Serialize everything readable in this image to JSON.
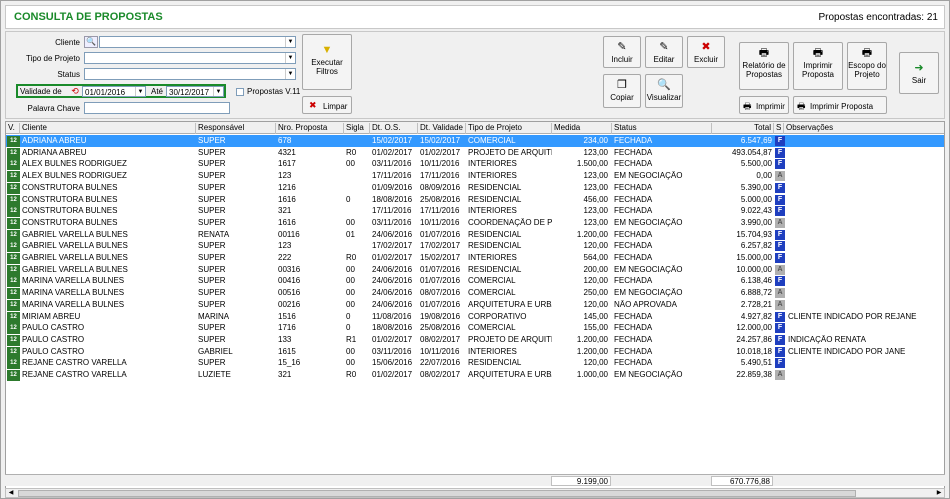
{
  "title": "CONSULTA DE PROPOSTAS",
  "found": "Propostas encontradas: 21",
  "filters": {
    "cliente_label": "Cliente",
    "tipo_label": "Tipo de Projeto",
    "status_label": "Status",
    "validade_label": "Validade de",
    "validade_from": "01/01/2016",
    "ate_label": "Até",
    "validade_to": "30/12/2017",
    "propostas_v11_label": "Propostas V.11",
    "palavra_label": "Palavra Chave"
  },
  "buttons": {
    "executar": "Executar Filtros",
    "limpar": "Limpar",
    "incluir": "Incluir",
    "editar": "Editar",
    "excluir": "Excluir",
    "copiar": "Copiar",
    "visualizar": "Visualizar",
    "relatorio": "Relatório de Propostas",
    "imprimir_proposta_big": "Imprimir Proposta",
    "escopo": "Escopo do Projeto",
    "imprimir": "Imprimir",
    "imprimir_proposta": "Imprimir Proposta",
    "sair": "Sair"
  },
  "columns": [
    "V.",
    "Cliente",
    "Responsável",
    "Nro. Proposta",
    "Sigla",
    "Dt. O.S.",
    "Dt. Validade",
    "Tipo de Projeto",
    "Medida",
    "Status",
    "Total",
    "S",
    "Observações"
  ],
  "rows": [
    {
      "v": "12",
      "cliente": "ADRIANA ABREU",
      "resp": "SUPER",
      "nro": "678",
      "sigla": "",
      "dtos": "15/02/2017",
      "dtval": "15/02/2017",
      "tipo": "COMERCIAL",
      "medida": "234,00",
      "status": "FECHADA",
      "total": "6.547,69",
      "s": "F",
      "obs": ""
    },
    {
      "v": "12",
      "cliente": "ADRIANA ABREU",
      "resp": "SUPER",
      "nro": "4321",
      "sigla": "R0",
      "dtos": "01/02/2017",
      "dtval": "01/02/2017",
      "tipo": "PROJETO DE ARQUITE",
      "medida": "123,00",
      "status": "FECHADA",
      "total": "493.054,87",
      "s": "F",
      "obs": ""
    },
    {
      "v": "12",
      "cliente": "ALEX BULNES RODRIGUEZ",
      "resp": "SUPER",
      "nro": "1617",
      "sigla": "00",
      "dtos": "03/11/2016",
      "dtval": "10/11/2016",
      "tipo": "INTERIORES",
      "medida": "1.500,00",
      "status": "FECHADA",
      "total": "5.500,00",
      "s": "F",
      "obs": ""
    },
    {
      "v": "12",
      "cliente": "ALEX BULNES RODRIGUEZ",
      "resp": "SUPER",
      "nro": "123",
      "sigla": "",
      "dtos": "17/11/2016",
      "dtval": "17/11/2016",
      "tipo": "INTERIORES",
      "medida": "123,00",
      "status": "EM NEGOCIAÇÃO",
      "total": "0,00",
      "s": "A",
      "obs": ""
    },
    {
      "v": "12",
      "cliente": "CONSTRUTORA BULNES",
      "resp": "SUPER",
      "nro": "1216",
      "sigla": "",
      "dtos": "01/09/2016",
      "dtval": "08/09/2016",
      "tipo": "RESIDENCIAL",
      "medida": "123,00",
      "status": "FECHADA",
      "total": "5.390,00",
      "s": "F",
      "obs": ""
    },
    {
      "v": "12",
      "cliente": "CONSTRUTORA BULNES",
      "resp": "SUPER",
      "nro": "1616",
      "sigla": "0",
      "dtos": "18/08/2016",
      "dtval": "25/08/2016",
      "tipo": "RESIDENCIAL",
      "medida": "456,00",
      "status": "FECHADA",
      "total": "5.000,00",
      "s": "F",
      "obs": ""
    },
    {
      "v": "12",
      "cliente": "CONSTRUTORA BULNES",
      "resp": "SUPER",
      "nro": "321",
      "sigla": "",
      "dtos": "17/11/2016",
      "dtval": "17/11/2016",
      "tipo": "INTERIORES",
      "medida": "123,00",
      "status": "FECHADA",
      "total": "9.022,43",
      "s": "F",
      "obs": ""
    },
    {
      "v": "12",
      "cliente": "CONSTRUTORA BULNES",
      "resp": "SUPER",
      "nro": "1616",
      "sigla": "00",
      "dtos": "03/11/2016",
      "dtval": "10/11/2016",
      "tipo": "COORDENAÇÃO DE PF",
      "medida": "123,00",
      "status": "EM NEGOCIAÇÃO",
      "total": "3.990,00",
      "s": "A",
      "obs": ""
    },
    {
      "v": "12",
      "cliente": "GABRIEL VARELLA BULNES",
      "resp": "RENATA",
      "nro": "00116",
      "sigla": "01",
      "dtos": "24/06/2016",
      "dtval": "01/07/2016",
      "tipo": "RESIDENCIAL",
      "medida": "1.200,00",
      "status": "FECHADA",
      "total": "15.704,93",
      "s": "F",
      "obs": ""
    },
    {
      "v": "12",
      "cliente": "GABRIEL VARELLA BULNES",
      "resp": "SUPER",
      "nro": "123",
      "sigla": "",
      "dtos": "17/02/2017",
      "dtval": "17/02/2017",
      "tipo": "RESIDENCIAL",
      "medida": "120,00",
      "status": "FECHADA",
      "total": "6.257,82",
      "s": "F",
      "obs": ""
    },
    {
      "v": "12",
      "cliente": "GABRIEL VARELLA BULNES",
      "resp": "SUPER",
      "nro": "222",
      "sigla": "R0",
      "dtos": "01/02/2017",
      "dtval": "15/02/2017",
      "tipo": "INTERIORES",
      "medida": "564,00",
      "status": "FECHADA",
      "total": "15.000,00",
      "s": "F",
      "obs": ""
    },
    {
      "v": "12",
      "cliente": "GABRIEL VARELLA BULNES",
      "resp": "SUPER",
      "nro": "00316",
      "sigla": "00",
      "dtos": "24/06/2016",
      "dtval": "01/07/2016",
      "tipo": "RESIDENCIAL",
      "medida": "200,00",
      "status": "EM NEGOCIAÇÃO",
      "total": "10.000,00",
      "s": "A",
      "obs": ""
    },
    {
      "v": "12",
      "cliente": "MARINA VARELLA BULNES",
      "resp": "SUPER",
      "nro": "00416",
      "sigla": "00",
      "dtos": "24/06/2016",
      "dtval": "01/07/2016",
      "tipo": "COMERCIAL",
      "medida": "120,00",
      "status": "FECHADA",
      "total": "6.138,46",
      "s": "F",
      "obs": ""
    },
    {
      "v": "12",
      "cliente": "MARINA VARELLA BULNES",
      "resp": "SUPER",
      "nro": "00516",
      "sigla": "00",
      "dtos": "24/06/2016",
      "dtval": "08/07/2016",
      "tipo": "COMERCIAL",
      "medida": "250,00",
      "status": "EM NEGOCIAÇÃO",
      "total": "6.888,72",
      "s": "A",
      "obs": ""
    },
    {
      "v": "12",
      "cliente": "MARINA VARELLA BULNES",
      "resp": "SUPER",
      "nro": "00216",
      "sigla": "00",
      "dtos": "24/06/2016",
      "dtval": "01/07/2016",
      "tipo": "ARQUITETURA E URBA",
      "medida": "120,00",
      "status": "NÃO APROVADA",
      "total": "2.728,21",
      "s": "A",
      "obs": ""
    },
    {
      "v": "12",
      "cliente": "MIRIAM ABREU",
      "resp": "MARINA",
      "nro": "1516",
      "sigla": "0",
      "dtos": "11/08/2016",
      "dtval": "19/08/2016",
      "tipo": "CORPORATIVO",
      "medida": "145,00",
      "status": "FECHADA",
      "total": "4.927,82",
      "s": "F",
      "obs": "CLIENTE INDICADO POR REJANE"
    },
    {
      "v": "12",
      "cliente": "PAULO CASTRO",
      "resp": "SUPER",
      "nro": "1716",
      "sigla": "0",
      "dtos": "18/08/2016",
      "dtval": "25/08/2016",
      "tipo": "COMERCIAL",
      "medida": "155,00",
      "status": "FECHADA",
      "total": "12.000,00",
      "s": "F",
      "obs": ""
    },
    {
      "v": "12",
      "cliente": "PAULO CASTRO",
      "resp": "SUPER",
      "nro": "133",
      "sigla": "R1",
      "dtos": "01/02/2017",
      "dtval": "08/02/2017",
      "tipo": "PROJETO DE ARQUITE",
      "medida": "1.200,00",
      "status": "FECHADA",
      "total": "24.257,86",
      "s": "F",
      "obs": "INDICAÇÃO RENATA"
    },
    {
      "v": "12",
      "cliente": "PAULO CASTRO",
      "resp": "GABRIEL",
      "nro": "1615",
      "sigla": "00",
      "dtos": "03/11/2016",
      "dtval": "10/11/2016",
      "tipo": "INTERIORES",
      "medida": "1.200,00",
      "status": "FECHADA",
      "total": "10.018,18",
      "s": "F",
      "obs": "CLIENTE INDICADO POR JANE"
    },
    {
      "v": "12",
      "cliente": "REJANE CASTRO VARELLA",
      "resp": "SUPER",
      "nro": "15_16",
      "sigla": "00",
      "dtos": "15/06/2016",
      "dtval": "22/07/2016",
      "tipo": "RESIDENCIAL",
      "medida": "120,00",
      "status": "FECHADA",
      "total": "5.490,51",
      "s": "F",
      "obs": ""
    },
    {
      "v": "12",
      "cliente": "REJANE CASTRO VARELLA",
      "resp": "LUZIETE",
      "nro": "321",
      "sigla": "R0",
      "dtos": "01/02/2017",
      "dtval": "08/02/2017",
      "tipo": "ARQUITETURA E URBA",
      "medida": "1.000,00",
      "status": "EM NEGOCIAÇÃO",
      "total": "22.859,38",
      "s": "A",
      "obs": ""
    }
  ],
  "footer": {
    "medida_total": "9.199,00",
    "total_total": "670.776,88"
  }
}
